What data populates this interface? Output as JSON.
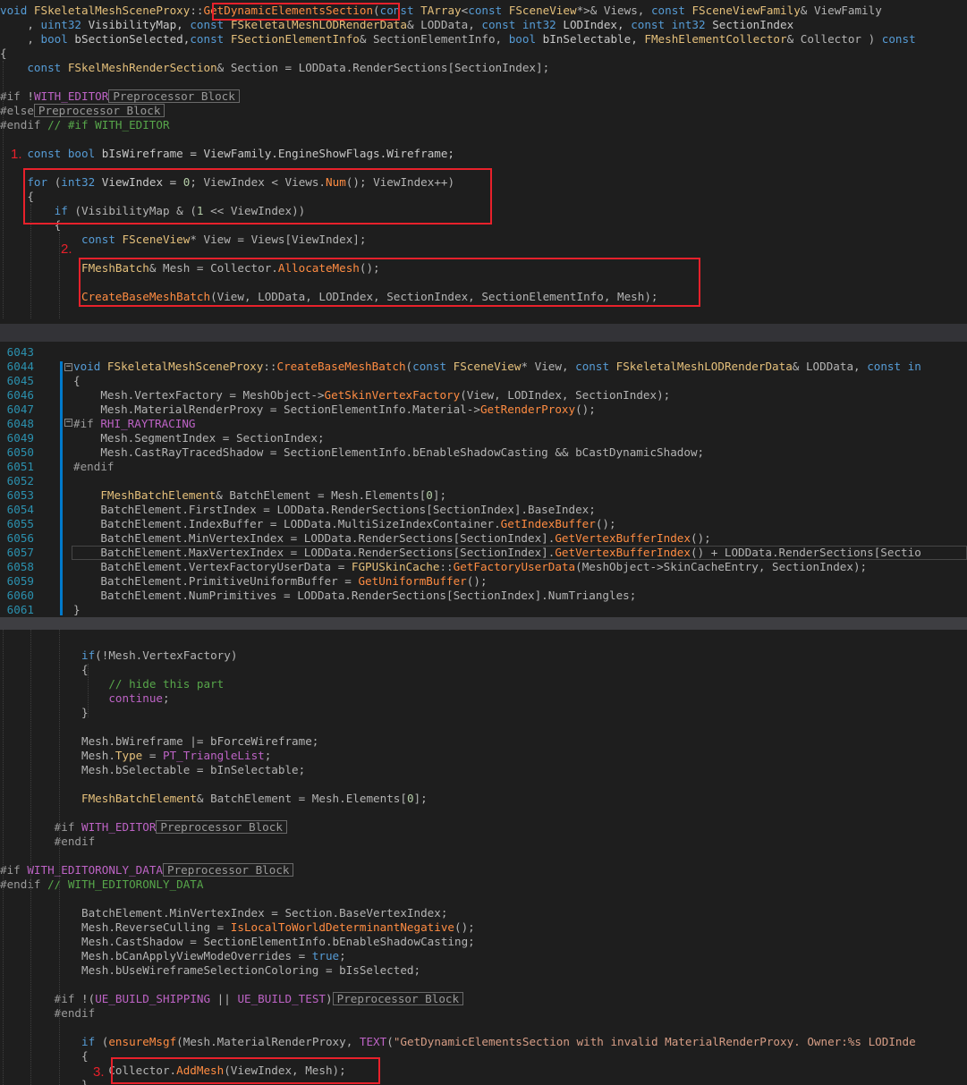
{
  "top": {
    "lines": [
      [
        [
          "kw",
          "void "
        ],
        [
          "cls",
          "FSkeletalMeshSceneProxy"
        ],
        [
          "op",
          "::"
        ],
        [
          "fn",
          "GetDynamicElementsSection"
        ],
        [
          "op",
          "("
        ],
        [
          "kw",
          "const "
        ],
        [
          "cls",
          "TArray"
        ],
        [
          "op",
          "<"
        ],
        [
          "kw",
          "const "
        ],
        [
          "cls",
          "FSceneView"
        ],
        [
          "op",
          "*>& Views, "
        ],
        [
          "kw",
          "const "
        ],
        [
          "cls",
          "FSceneViewFamily"
        ],
        [
          "op",
          "& ViewFamily"
        ]
      ],
      [
        [
          "op",
          "    , "
        ],
        [
          "kw",
          "uint32 "
        ],
        [
          "var",
          "VisibilityMap, "
        ],
        [
          "kw",
          "const "
        ],
        [
          "cls",
          "FSkeletalMeshLODRenderData"
        ],
        [
          "op",
          "& LODData, "
        ],
        [
          "kw",
          "const int32 "
        ],
        [
          "var",
          "LODIndex, "
        ],
        [
          "kw",
          "const int32 "
        ],
        [
          "var",
          "SectionIndex"
        ]
      ],
      [
        [
          "op",
          "    , "
        ],
        [
          "kw",
          "bool "
        ],
        [
          "var",
          "bSectionSelected,"
        ],
        [
          "kw",
          "const "
        ],
        [
          "cls",
          "FSectionElementInfo"
        ],
        [
          "op",
          "& SectionElementInfo, "
        ],
        [
          "kw",
          "bool "
        ],
        [
          "var",
          "bInSelectable, "
        ],
        [
          "cls",
          "FMeshElementCollector"
        ],
        [
          "op",
          "& Collector ) "
        ],
        [
          "kw",
          "const"
        ]
      ],
      [
        [
          "op",
          "{"
        ]
      ],
      [
        [
          "op",
          "    "
        ],
        [
          "kw",
          "const "
        ],
        [
          "cls",
          "FSkelMeshRenderSection"
        ],
        [
          "op",
          "& Section = LODData.RenderSections[SectionIndex];"
        ]
      ],
      [],
      [
        [
          "pp",
          "#if "
        ],
        [
          "op",
          "!"
        ],
        [
          "mac",
          "WITH_EDITOR"
        ],
        [
          "pb",
          "Preprocessor Block"
        ]
      ],
      [
        [
          "pp",
          "#else"
        ],
        [
          "pb",
          "Preprocessor Block"
        ]
      ],
      [
        [
          "pp",
          "#endif "
        ],
        [
          "cm",
          "// #if WITH_EDITOR"
        ]
      ],
      [],
      [
        [
          "op",
          "    "
        ],
        [
          "kw",
          "const bool "
        ],
        [
          "var",
          "bIsWireframe = ViewFamily.EngineShowFlags.Wireframe;"
        ]
      ],
      [],
      [
        [
          "op",
          "    "
        ],
        [
          "kw",
          "for "
        ],
        [
          "op",
          "("
        ],
        [
          "kw",
          "int32 "
        ],
        [
          "var",
          "ViewIndex = "
        ],
        [
          "num",
          "0"
        ],
        [
          "op",
          "; ViewIndex < Views."
        ],
        [
          "fn",
          "Num"
        ],
        [
          "op",
          "(); ViewIndex++)"
        ]
      ],
      [
        [
          "op",
          "    {"
        ]
      ],
      [
        [
          "op",
          "        "
        ],
        [
          "kw",
          "if "
        ],
        [
          "op",
          "(VisibilityMap & ("
        ],
        [
          "num",
          "1"
        ],
        [
          "op",
          " << ViewIndex))"
        ]
      ],
      [
        [
          "op",
          "        {"
        ]
      ],
      [
        [
          "op",
          "            "
        ],
        [
          "kw",
          "const "
        ],
        [
          "cls",
          "FSceneView"
        ],
        [
          "op",
          "* View = Views[ViewIndex];"
        ]
      ],
      [],
      [
        [
          "op",
          "            "
        ],
        [
          "cls",
          "FMeshBatch"
        ],
        [
          "op",
          "& Mesh = Collector."
        ],
        [
          "fn",
          "AllocateMesh"
        ],
        [
          "op",
          "();"
        ]
      ],
      [],
      [
        [
          "op",
          "            "
        ],
        [
          "fn",
          "CreateBaseMeshBatch"
        ],
        [
          "op",
          "(View, LODData, LODIndex, SectionIndex, SectionElementInfo, Mesh);"
        ]
      ]
    ],
    "labels": [
      "1.",
      "2."
    ]
  },
  "middle": {
    "numbers": [
      "6043",
      "6044",
      "6045",
      "6046",
      "6047",
      "6048",
      "6049",
      "6050",
      "6051",
      "6052",
      "6053",
      "6054",
      "6055",
      "6056",
      "6057",
      "6058",
      "6059",
      "6060",
      "6061"
    ],
    "lines": [
      [],
      [
        [
          "kw",
          "void "
        ],
        [
          "cls",
          "FSkeletalMeshSceneProxy"
        ],
        [
          "op",
          "::"
        ],
        [
          "fn",
          "CreateBaseMeshBatch"
        ],
        [
          "op",
          "("
        ],
        [
          "kw",
          "const "
        ],
        [
          "cls",
          "FSceneView"
        ],
        [
          "op",
          "* View, "
        ],
        [
          "kw",
          "const "
        ],
        [
          "cls",
          "FSkeletalMeshLODRenderData"
        ],
        [
          "op",
          "& LODData, "
        ],
        [
          "kw",
          "const in"
        ]
      ],
      [
        [
          "op",
          "{"
        ]
      ],
      [
        [
          "op",
          "    Mesh.VertexFactory = MeshObject->"
        ],
        [
          "fn",
          "GetSkinVertexFactory"
        ],
        [
          "op",
          "(View, LODIndex, SectionIndex);"
        ]
      ],
      [
        [
          "op",
          "    Mesh.MaterialRenderProxy = SectionElementInfo.Material->"
        ],
        [
          "fn",
          "GetRenderProxy"
        ],
        [
          "op",
          "();"
        ]
      ],
      [
        [
          "pp",
          "#if "
        ],
        [
          "mac",
          "RHI_RAYTRACING"
        ]
      ],
      [
        [
          "op",
          "    Mesh.SegmentIndex = SectionIndex;"
        ]
      ],
      [
        [
          "op",
          "    Mesh.CastRayTracedShadow = SectionElementInfo.bEnableShadowCasting && bCastDynamicShadow;"
        ]
      ],
      [
        [
          "pp",
          "#endif"
        ]
      ],
      [],
      [
        [
          "op",
          "    "
        ],
        [
          "cls",
          "FMeshBatchElement"
        ],
        [
          "op",
          "& BatchElement = Mesh.Elements["
        ],
        [
          "num",
          "0"
        ],
        [
          "op",
          "];"
        ]
      ],
      [
        [
          "op",
          "    BatchElement.FirstIndex = LODData.RenderSections[SectionIndex].BaseIndex;"
        ]
      ],
      [
        [
          "op",
          "    BatchElement.IndexBuffer = LODData.MultiSizeIndexContainer."
        ],
        [
          "fn",
          "GetIndexBuffer"
        ],
        [
          "op",
          "();"
        ]
      ],
      [
        [
          "op",
          "    BatchElement.MinVertexIndex = LODData.RenderSections[SectionIndex]."
        ],
        [
          "fn",
          "GetVertexBufferIndex"
        ],
        [
          "op",
          "();"
        ]
      ],
      [
        [
          "op",
          "    BatchElement.MaxVertexIndex = LODData.RenderSections[SectionIndex]."
        ],
        [
          "fn",
          "GetVertexBufferIndex"
        ],
        [
          "op",
          "() + LODData.RenderSections[Sectio"
        ]
      ],
      [
        [
          "op",
          "    BatchElement.VertexFactoryUserData = "
        ],
        [
          "cls",
          "FGPUSkinCache"
        ],
        [
          "op",
          "::"
        ],
        [
          "fn",
          "GetFactoryUserData"
        ],
        [
          "op",
          "(MeshObject->SkinCacheEntry, SectionIndex);"
        ]
      ],
      [
        [
          "op",
          "    BatchElement.PrimitiveUniformBuffer = "
        ],
        [
          "fn",
          "GetUniformBuffer"
        ],
        [
          "op",
          "();"
        ]
      ],
      [
        [
          "op",
          "    BatchElement.NumPrimitives = LODData.RenderSections[SectionIndex].NumTriangles;"
        ]
      ],
      [
        [
          "op",
          "}"
        ]
      ]
    ]
  },
  "bottom": {
    "lines": [
      [],
      [
        [
          "op",
          "            "
        ],
        [
          "kw",
          "if"
        ],
        [
          "op",
          "(!Mesh.VertexFactory)"
        ]
      ],
      [
        [
          "op",
          "            {"
        ]
      ],
      [
        [
          "op",
          "                "
        ],
        [
          "cm",
          "// hide this part"
        ]
      ],
      [
        [
          "op",
          "                "
        ],
        [
          "mac",
          "continue"
        ],
        [
          "op",
          ";"
        ]
      ],
      [
        [
          "op",
          "            }"
        ]
      ],
      [],
      [
        [
          "op",
          "            Mesh.bWireframe |= bForceWireframe;"
        ]
      ],
      [
        [
          "op",
          "            Mesh."
        ],
        [
          "cls",
          "Type"
        ],
        [
          "op",
          " = "
        ],
        [
          "mac",
          "PT_TriangleList"
        ],
        [
          "op",
          ";"
        ]
      ],
      [
        [
          "op",
          "            Mesh.bSelectable = bInSelectable;"
        ]
      ],
      [],
      [
        [
          "op",
          "            "
        ],
        [
          "cls",
          "FMeshBatchElement"
        ],
        [
          "op",
          "& BatchElement = Mesh.Elements["
        ],
        [
          "num",
          "0"
        ],
        [
          "op",
          "];"
        ]
      ],
      [],
      [
        [
          "op",
          "        "
        ],
        [
          "pp",
          "#if "
        ],
        [
          "mac",
          "WITH_EDITOR"
        ],
        [
          "pb",
          "Preprocessor Block"
        ]
      ],
      [
        [
          "op",
          "        "
        ],
        [
          "pp",
          "#endif"
        ]
      ],
      [],
      [
        [
          "pp",
          "#if "
        ],
        [
          "mac",
          "WITH_EDITORONLY_DATA"
        ],
        [
          "pb",
          "Preprocessor Block"
        ]
      ],
      [
        [
          "pp",
          "#endif "
        ],
        [
          "cm",
          "// WITH_EDITORONLY_DATA"
        ]
      ],
      [],
      [
        [
          "op",
          "            BatchElement.MinVertexIndex = Section.BaseVertexIndex;"
        ]
      ],
      [
        [
          "op",
          "            Mesh.ReverseCulling = "
        ],
        [
          "fn",
          "IsLocalToWorldDeterminantNegative"
        ],
        [
          "op",
          "();"
        ]
      ],
      [
        [
          "op",
          "            Mesh.CastShadow = SectionElementInfo.bEnableShadowCasting;"
        ]
      ],
      [
        [
          "op",
          "            Mesh.bCanApplyViewModeOverrides = "
        ],
        [
          "kw",
          "true"
        ],
        [
          "op",
          ";"
        ]
      ],
      [
        [
          "op",
          "            Mesh.bUseWireframeSelectionColoring = bIsSelected;"
        ]
      ],
      [],
      [
        [
          "op",
          "        "
        ],
        [
          "pp",
          "#if "
        ],
        [
          "op",
          "!("
        ],
        [
          "mac",
          "UE_BUILD_SHIPPING"
        ],
        [
          "op",
          " || "
        ],
        [
          "mac",
          "UE_BUILD_TEST"
        ],
        [
          "op",
          ")"
        ],
        [
          "pb",
          "Preprocessor Block"
        ]
      ],
      [
        [
          "op",
          "        "
        ],
        [
          "pp",
          "#endif"
        ]
      ],
      [],
      [
        [
          "op",
          "            "
        ],
        [
          "kw",
          "if "
        ],
        [
          "op",
          "("
        ],
        [
          "fn",
          "ensureMsgf"
        ],
        [
          "op",
          "(Mesh.MaterialRenderProxy, "
        ],
        [
          "mac",
          "TEXT"
        ],
        [
          "op",
          "("
        ],
        [
          "str",
          "\"GetDynamicElementsSection with invalid MaterialRenderProxy. Owner:%s LODInde"
        ]
      ],
      [
        [
          "op",
          "            {"
        ]
      ],
      [
        [
          "op",
          "                Collector."
        ],
        [
          "fn",
          "AddMesh"
        ],
        [
          "op",
          "(ViewIndex, Mesh);"
        ]
      ],
      [
        [
          "op",
          "            }"
        ]
      ]
    ],
    "labels": [
      "3."
    ]
  }
}
